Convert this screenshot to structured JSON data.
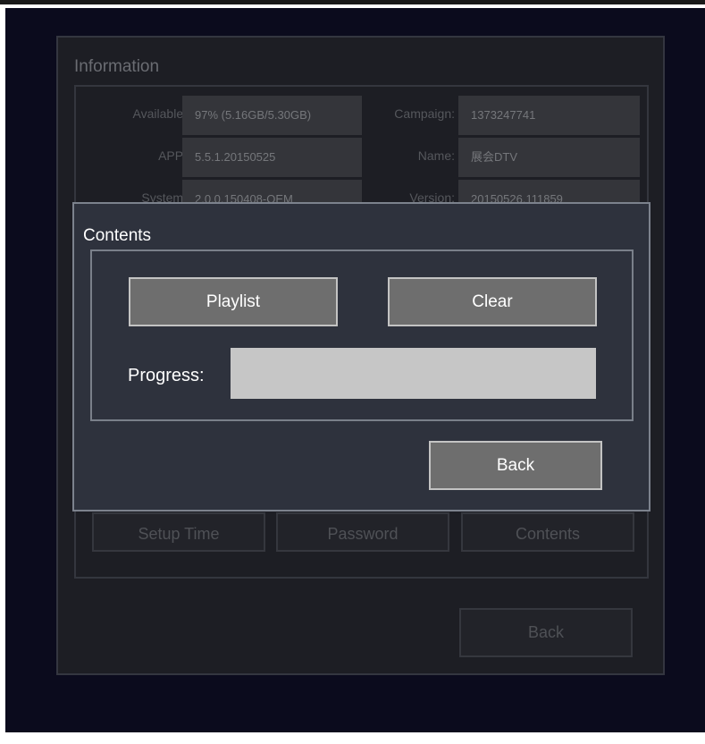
{
  "background_panel": {
    "title": "Information",
    "rows": [
      {
        "label_left": "Available:",
        "value_left": "97% (5.16GB/5.30GB)",
        "label_right": "Campaign:",
        "value_right": "1373247741"
      },
      {
        "label_left": "APP:",
        "value_left": "5.5.1.20150525",
        "label_right": "Name:",
        "value_right": "展会DTV"
      },
      {
        "label_left": "System:",
        "value_left": "2.0.0.150408-OEM",
        "label_right": "Version:",
        "value_right": "20150526.111859"
      }
    ],
    "buttons": {
      "setup_time": "Setup Time",
      "password": "Password",
      "contents": "Contents",
      "back": "Back"
    }
  },
  "dialog": {
    "title": "Contents",
    "playlist_button": "Playlist",
    "clear_button": "Clear",
    "progress_label": "Progress:",
    "progress_value": 0,
    "back_button": "Back"
  },
  "colors": {
    "screen_background": "#0b0b1d",
    "dialog_background": "#2e323d",
    "button_fill": "#6e6e6e",
    "progress_track": "#c6c6c6"
  }
}
